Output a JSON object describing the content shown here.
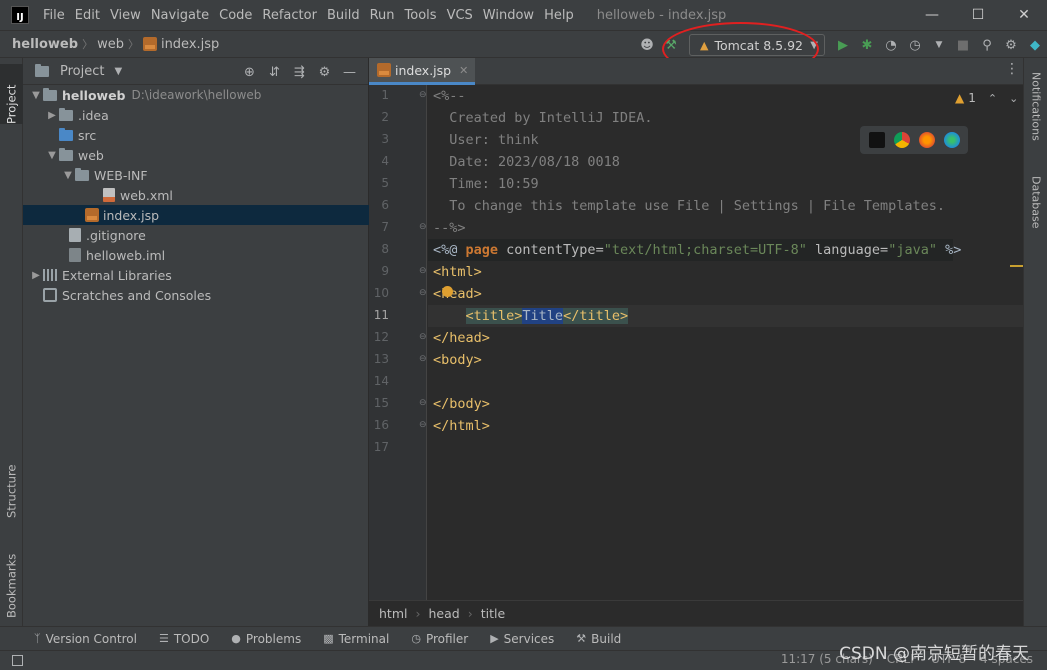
{
  "app": {
    "logo_text": "IJ",
    "window_title": "helloweb - index.jsp",
    "menu": [
      "File",
      "Edit",
      "View",
      "Navigate",
      "Code",
      "Refactor",
      "Build",
      "Run",
      "Tools",
      "VCS",
      "Window",
      "Help"
    ],
    "window_controls": [
      "—",
      "☐",
      "✕"
    ]
  },
  "navbar": {
    "breadcrumbs": [
      "helloweb",
      "web",
      "index.jsp"
    ],
    "run_config": "Tomcat 8.5.92"
  },
  "left_strip": {
    "project": "Project",
    "structure": "Structure",
    "bookmarks": "Bookmarks"
  },
  "right_strip": {
    "notifications": "Notifications",
    "database": "Database"
  },
  "project_panel": {
    "title": "Project",
    "tree": [
      {
        "label": "helloweb",
        "note": "D:\\ideawork\\helloweb"
      },
      {
        "label": ".idea"
      },
      {
        "label": "src"
      },
      {
        "label": "web"
      },
      {
        "label": "WEB-INF"
      },
      {
        "label": "web.xml"
      },
      {
        "label": "index.jsp"
      },
      {
        "label": ".gitignore"
      },
      {
        "label": "helloweb.iml"
      },
      {
        "label": "External Libraries"
      },
      {
        "label": "Scratches and Consoles"
      }
    ]
  },
  "editor": {
    "tab": "index.jsp",
    "inspection_count": "1",
    "line_numbers": [
      "1",
      "2",
      "3",
      "4",
      "5",
      "6",
      "7",
      "8",
      "9",
      "10",
      "11",
      "12",
      "13",
      "14",
      "15",
      "16",
      "17"
    ],
    "comment_lines": [
      "<%--",
      "  Created by IntelliJ IDEA.",
      "  User: think",
      "  Date: 2023/08/18 0018",
      "  Time: 10:59",
      "  To change this template use File | Settings | File Templates.",
      "--%>"
    ],
    "directive": {
      "open": "<%@ ",
      "keyword": "page",
      "attr1": " contentType=",
      "val1": "\"text/html;charset=UTF-8\"",
      "attr2": " language=",
      "val2": "\"java\"",
      "close": " %>"
    },
    "html_open": "<html>",
    "head_open": "<head>",
    "title_open": "<title>",
    "title_text": "Title",
    "title_close": "</title>",
    "head_close": "</head>",
    "body_open": "<body>",
    "body_close": "</body>",
    "html_close": "</html>",
    "breadcrumb": [
      "html",
      "head",
      "title"
    ]
  },
  "bottom_tools": [
    {
      "icon": "git-branch-icon",
      "label": "Version Control"
    },
    {
      "icon": "todo-icon",
      "label": "TODO"
    },
    {
      "icon": "problems-icon",
      "label": "Problems"
    },
    {
      "icon": "terminal-icon",
      "label": "Terminal"
    },
    {
      "icon": "profiler-icon",
      "label": "Profiler"
    },
    {
      "icon": "services-icon",
      "label": "Services"
    },
    {
      "icon": "build-icon",
      "label": "Build"
    }
  ],
  "status": {
    "position": "11:17 (5 chars)",
    "line_sep": "CRLF",
    "encoding": "UTF-8",
    "indent": "4 spaces"
  },
  "watermark": "CSDN @南京短暂的春天",
  "colors": {
    "accent": "#4a88c7",
    "annotation": "#e02020",
    "tag": "#e8bf6a",
    "keyword": "#cc7832",
    "string": "#6a8759"
  }
}
